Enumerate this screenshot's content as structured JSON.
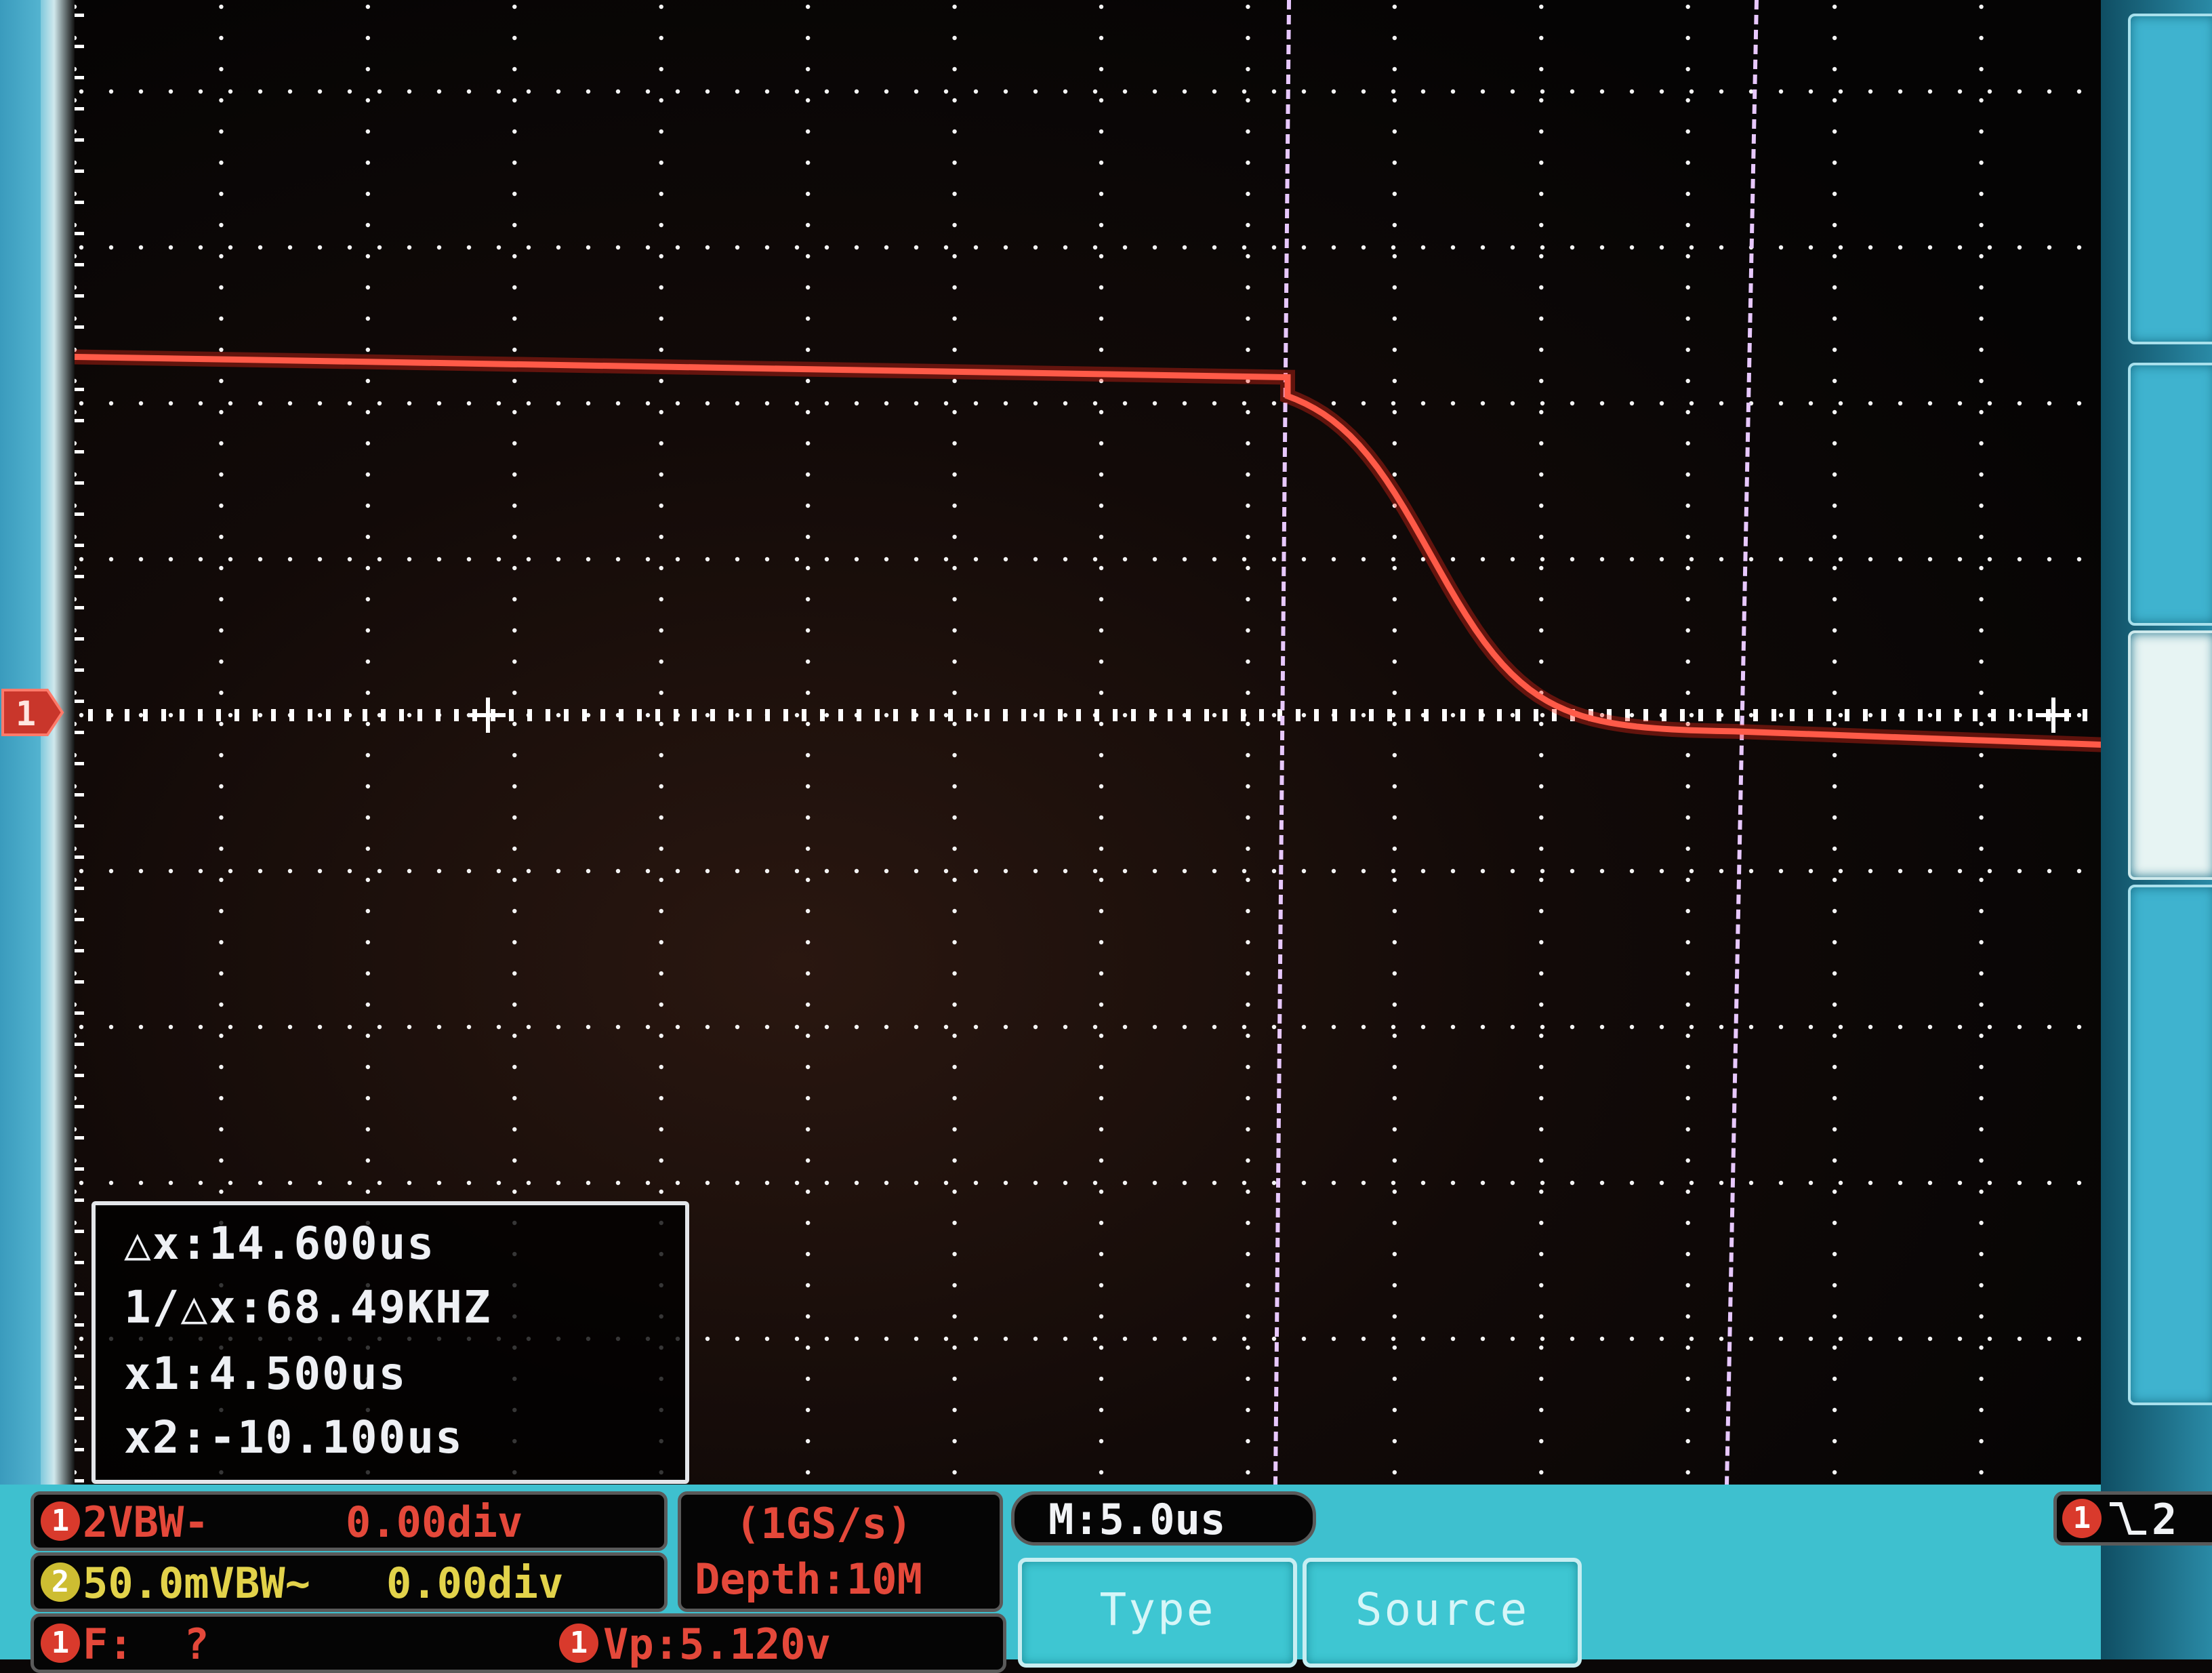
{
  "screen": {
    "brand_color": "#3ec0cf",
    "trace_color": "#ff5a48",
    "cursor_color": "#e8c8ff",
    "grid_color": "#f4f4f4"
  },
  "channel_marker": {
    "label": "1",
    "color": "#e4483a"
  },
  "cursor_readout": {
    "delta_x": "△x:14.600us",
    "inverse_delta_x": "1/△x:68.49KHZ",
    "x1": "x1:4.500us",
    "x2": "x2:-10.100us"
  },
  "status_bar": {
    "ch1": {
      "badge": "1",
      "scale": "2VBW-",
      "offset": "0.00div",
      "color": "#e4483a"
    },
    "ch2": {
      "badge": "2",
      "scale": "50.0mVBW~",
      "offset": "0.00div",
      "color": "#e2d24a"
    },
    "frequency": {
      "badge": "1",
      "text": "F:  ?"
    },
    "sample_rate": "(1GS/s)",
    "depth": "Depth:10M",
    "vpp": {
      "badge": "1",
      "text": "Vp:5.120v"
    },
    "timebase": "M:5.0us",
    "trigger": {
      "badge": "1",
      "slope_icon": "falling-edge-icon",
      "level": "2"
    }
  },
  "softkeys": [
    {
      "label": "Type"
    },
    {
      "label": "Source"
    }
  ],
  "waveform": {
    "channel": "1",
    "shape": "falling-edge",
    "high_level_div": 2.5,
    "low_level_div": -0.1,
    "transition_time_us": 14.6
  }
}
